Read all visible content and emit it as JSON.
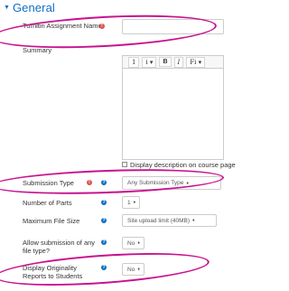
{
  "section": {
    "title": "General"
  },
  "fields": {
    "assignment_name": {
      "label": "Turnitin Assignment Name",
      "value": ""
    },
    "summary": {
      "label": "Summary",
      "toolbar": [
        "1",
        "i ▾",
        "B",
        "I",
        "Fi ▾"
      ]
    },
    "display_description": {
      "label": "Display description on course page"
    },
    "submission_type": {
      "label": "Submission Type",
      "value": "Any Submission Type"
    },
    "number_of_parts": {
      "label": "Number of Parts",
      "value": "1"
    },
    "max_file_size": {
      "label": "Maximum File Size",
      "value": "Site upload limit (40MB)"
    },
    "allow_any_file": {
      "label": "Allow submission of any file type?",
      "value": "No"
    },
    "originality_reports": {
      "label": "Display Originality Reports to Students",
      "value": "No"
    }
  },
  "icons": {
    "required": "!",
    "help": "?",
    "dropdown_caret": "♦"
  },
  "colors": {
    "section_title": "#0f6fc5",
    "required": "#d9534f",
    "help": "#0f6fc5",
    "annotation": "#c8128f"
  }
}
